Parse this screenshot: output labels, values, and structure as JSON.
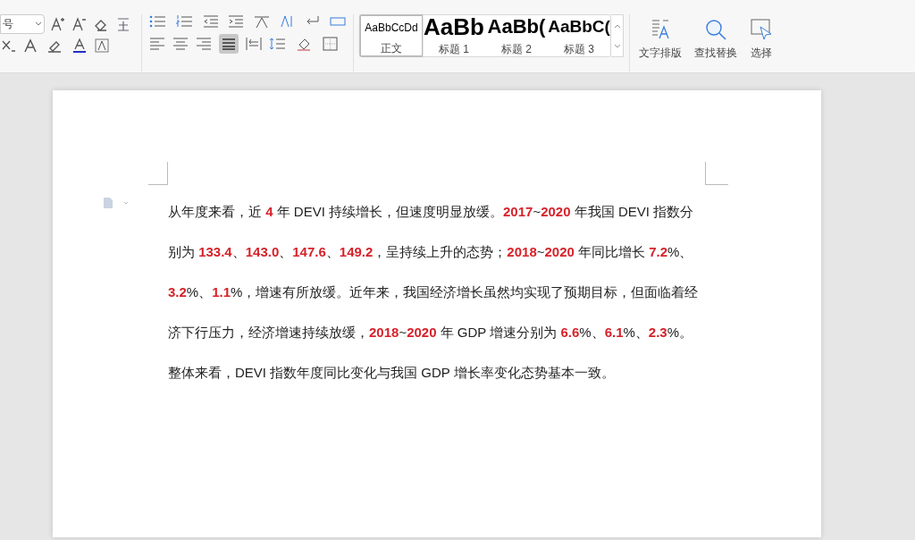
{
  "toolbar": {
    "font_size": "号",
    "styles": [
      {
        "sample": "AaBbCcDd",
        "label": "正文",
        "selected": true,
        "kind": "body"
      },
      {
        "sample": "AaBb",
        "label": "标题 1",
        "selected": false,
        "kind": "h1"
      },
      {
        "sample": "AaBb(",
        "label": "标题 2",
        "selected": false,
        "kind": "h2"
      },
      {
        "sample": "AaBbC(",
        "label": "标题 3",
        "selected": false,
        "kind": "h3"
      }
    ],
    "big_buttons": [
      {
        "label": "文字排版",
        "kind": "layout"
      },
      {
        "label": "查找替换",
        "kind": "find"
      },
      {
        "label": "选择",
        "kind": "select"
      }
    ]
  },
  "document": {
    "paragraph_lines": [
      "从年度来看，近 **4** 年 DEVI 持续增长，但速度明显放缓。**2017**~**2020** 年我国 DEVI 指数分",
      "别为 **133.4**、**143.0**、**147.6**、**149.2**，呈持续上升的态势；**2018**~**2020** 年同比增长 **7.2**%、",
      "**3.2**%、**1.1**%，增速有所放缓。近年来，我国经济增长虽然均实现了预期目标，但面临着经",
      "济下行压力，经济增速持续放缓，**2018**~**2020** 年 GDP 增速分别为 **6.6**%、**6.1**%、**2.3**%。",
      "整体来看，DEVI 指数年度同比变化与我国 GDP 增长率变化态势基本一致。"
    ]
  }
}
